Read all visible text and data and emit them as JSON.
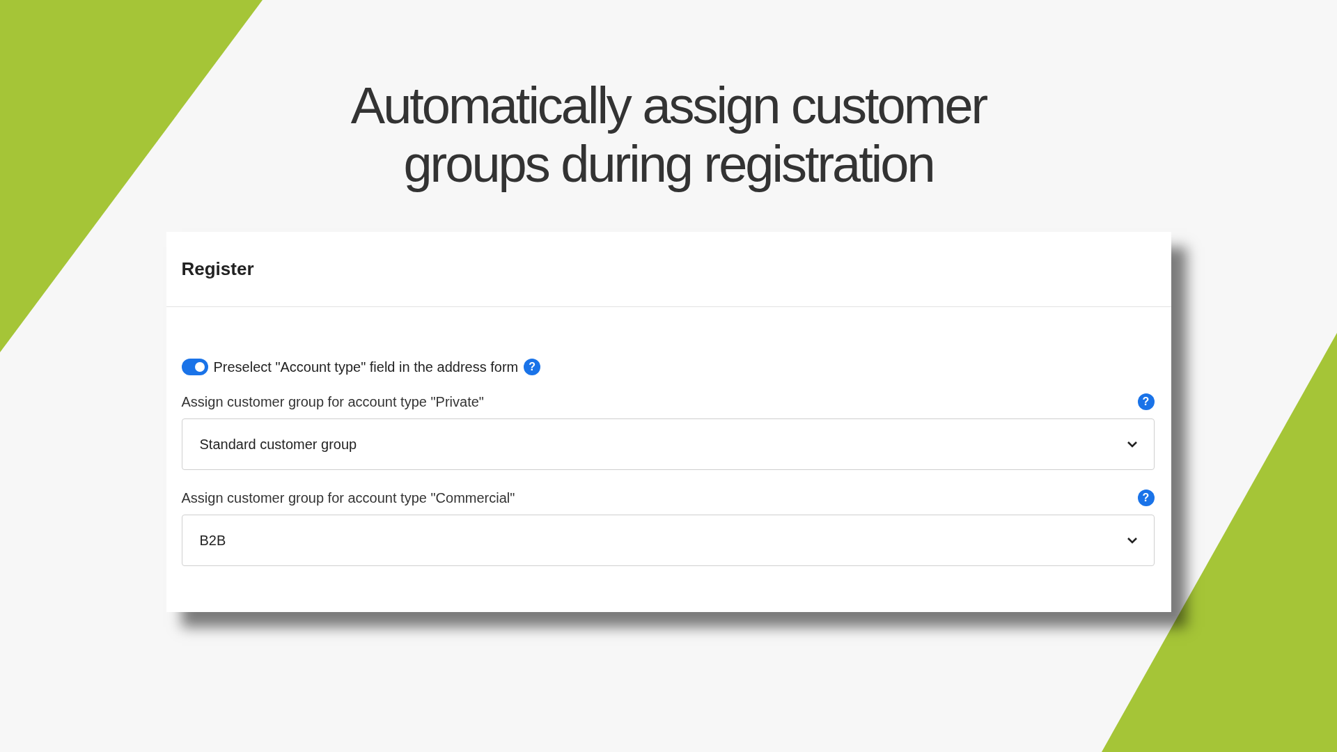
{
  "headline_lines": [
    "Automatically assign customer",
    "groups during registration"
  ],
  "card": {
    "title": "Register",
    "toggle": {
      "label": "Preselect \"Account type\" field in the address form",
      "on": true,
      "help": "?"
    },
    "selects": [
      {
        "label": "Assign customer group for account type \"Private\"",
        "value": "Standard customer group",
        "help": "?"
      },
      {
        "label": "Assign customer group for account type \"Commercial\"",
        "value": "B2B",
        "help": "?"
      }
    ]
  }
}
